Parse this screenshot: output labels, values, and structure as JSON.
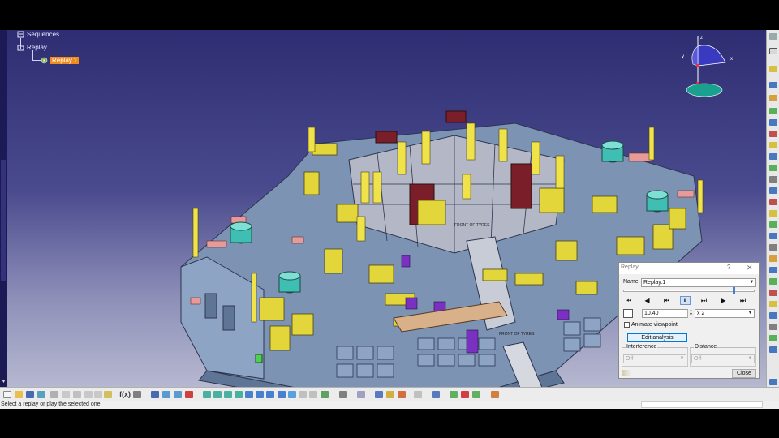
{
  "tree": {
    "root_label": "Sequences",
    "child_label": "Replay",
    "selected_label": "Replay.1"
  },
  "model": {
    "stamp_text_1": "FRONT OF TYRES",
    "stamp_text_2": "FRONT OF TYRES"
  },
  "compass": {
    "x_label": "x",
    "y_label": "y",
    "z_label": "z"
  },
  "dialog": {
    "title": "Replay",
    "help": "?",
    "close_x": "✕",
    "name_label": "Name:",
    "name_value": "Replay.1",
    "time_value": "10.40",
    "speed_value": "x 2",
    "animate_label": "Animate viewpoint",
    "edit_analysis_label": "Edit analysis",
    "interference_label": "Interference",
    "interference_value": "Off",
    "distance_label": "Distance",
    "distance_value": "Off",
    "close_label": "Close"
  },
  "bottom_toolbar": {
    "fxy_label": "f(x)"
  },
  "status": {
    "message": "Select a replay or play the selected one"
  },
  "colors": {
    "accent_selection": "#f08a1c",
    "viewport_top": "#2e2d72",
    "viewport_bottom": "#b6b8d0"
  }
}
